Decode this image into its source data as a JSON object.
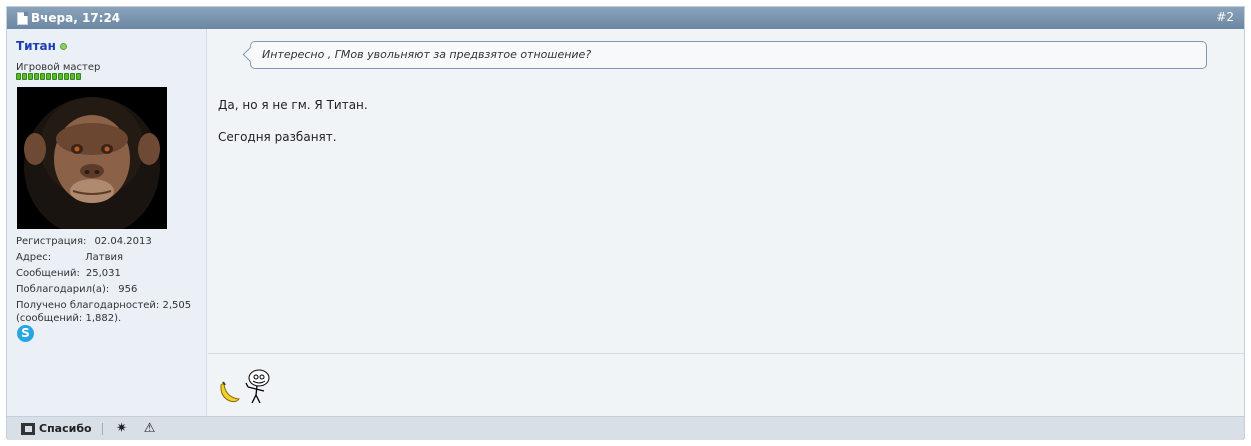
{
  "post": {
    "date": "Вчера, 17:24",
    "number": "#2"
  },
  "user": {
    "name": "Титан",
    "title": "Игровой мастер",
    "reputation_level": 11,
    "info": {
      "reg_label": "Регистрация:",
      "reg_value": "02.04.2013",
      "addr_label": "Адрес:",
      "addr_value": "Латвия",
      "posts_label": "Сообщений:",
      "posts_value": "25,031",
      "thanked_label": "Поблагодарил(а):",
      "thanked_value": "956",
      "received_line1": "Получено благодарностей: 2,505",
      "received_line2": "(сообщений: 1,882)."
    },
    "skype_glyph": "S"
  },
  "content": {
    "quote": "Интересно , ГМов увольняют за предвзятое отношение?",
    "message_line1": "Да, но я не гм. Я Титан.",
    "message_line2": "Сегодня разбанят."
  },
  "footer": {
    "thanks_label": "Спасибо",
    "star_glyph": "✷",
    "warning_glyph": "⚠"
  }
}
